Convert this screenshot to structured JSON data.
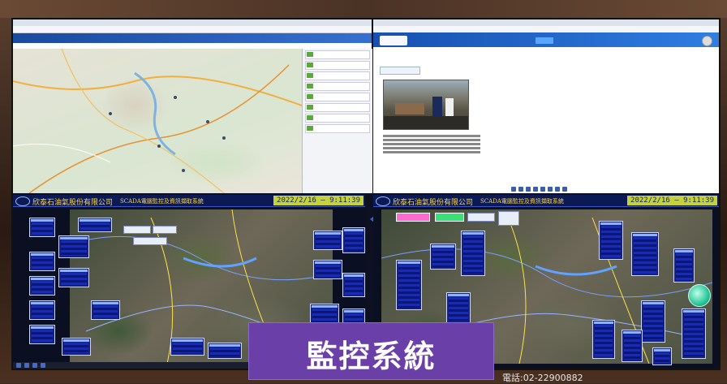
{
  "scene": {
    "scada_company": "欣泰石油氣股份有限公司",
    "scada_system": "SCADA電腦監控及資訊擷取系統",
    "scada_clock": "2022/2/16 — 9:11:39",
    "banner": "監控系統",
    "phone": "電話:02-22900882",
    "colors": {
      "banner": "#6b3fa8",
      "scada_title": "#0b1a55",
      "clock": "#c6d23a",
      "gold": "#ffd84d"
    }
  }
}
